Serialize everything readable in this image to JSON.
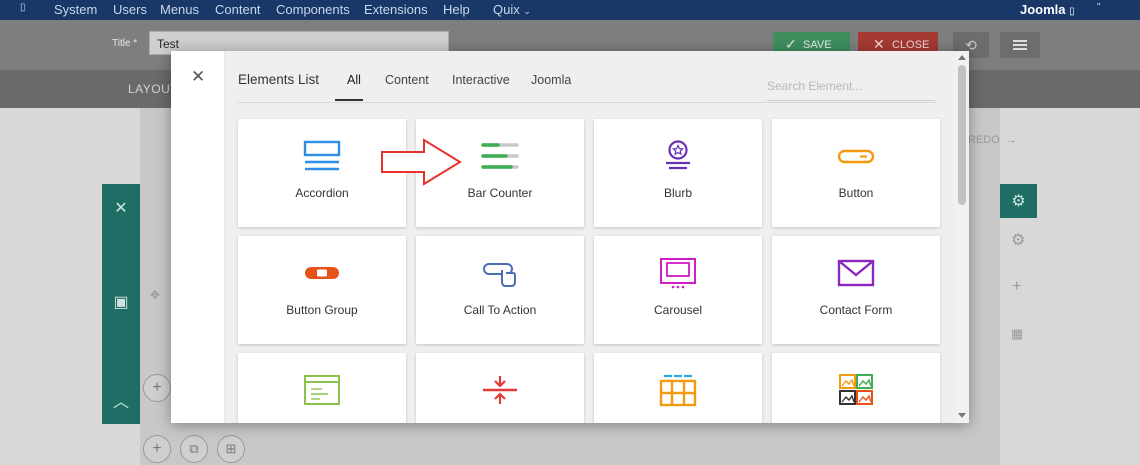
{
  "admin_menu": {
    "items": [
      "System",
      "Users",
      "Menus",
      "Content",
      "Components",
      "Extensions",
      "Help",
      "Quix"
    ],
    "site_name": "Joomla"
  },
  "toolbar": {
    "title_label": "Title *",
    "title_value": "Test",
    "save_label": "SAVE",
    "close_label": "CLOSE"
  },
  "builder": {
    "layout_tab": "LAYOUT",
    "redo_label": "REDO"
  },
  "modal": {
    "title": "Elements List",
    "tabs": [
      "All",
      "Content",
      "Interactive",
      "Joomla"
    ],
    "active_tab": "All",
    "search_placeholder": "Search Element...",
    "elements": [
      {
        "label": "Accordion",
        "icon": "accordion-icon"
      },
      {
        "label": "Bar Counter",
        "icon": "bar-counter-icon"
      },
      {
        "label": "Blurb",
        "icon": "blurb-icon"
      },
      {
        "label": "Button",
        "icon": "button-icon"
      },
      {
        "label": "Button Group",
        "icon": "button-group-icon"
      },
      {
        "label": "Call To Action",
        "icon": "call-to-action-icon"
      },
      {
        "label": "Carousel",
        "icon": "carousel-icon"
      },
      {
        "label": "Contact Form",
        "icon": "contact-form-icon"
      },
      {
        "label": "",
        "icon": "custom-html-icon"
      },
      {
        "label": "",
        "icon": "divider-icon"
      },
      {
        "label": "",
        "icon": "filterable-gallery-icon"
      },
      {
        "label": "",
        "icon": "gallery-icon"
      }
    ]
  },
  "colors": {
    "menubar": "#1a3867",
    "save": "#3f8f5f",
    "close": "#a53a34",
    "teal": "#1e6e66",
    "annotation_arrow": "#e8322b"
  }
}
